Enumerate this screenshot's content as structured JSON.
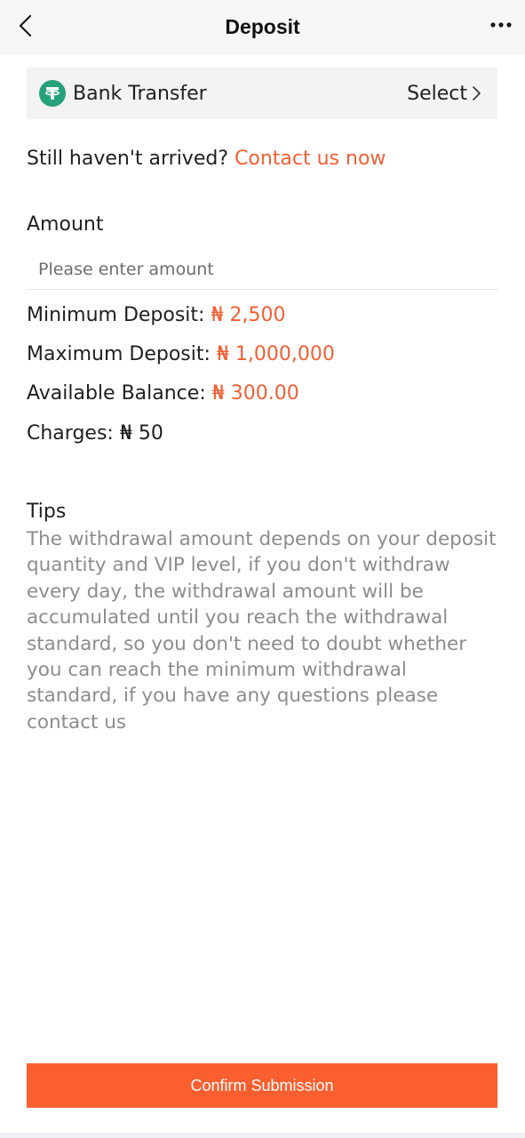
{
  "header": {
    "title": "Deposit",
    "back_icon": "chevron-left-icon",
    "more_icon": "more-dots-icon"
  },
  "payment_method": {
    "name": "Bank Transfer",
    "icon": "tether-icon",
    "icon_color": "#26a17b",
    "select_label": "Select"
  },
  "arrival": {
    "prompt": "Still haven't arrived?",
    "link": "Contact us now"
  },
  "amount": {
    "label": "Amount",
    "placeholder": "Please enter amount",
    "value": ""
  },
  "limits": {
    "min_label": "Minimum Deposit:",
    "min_value": "₦ 2,500",
    "max_label": "Maximum Deposit:",
    "max_value": "₦ 1,000,000",
    "balance_label": "Available Balance:",
    "balance_value": "₦ 300.00",
    "charges_label": "Charges:",
    "charges_value": "₦ 50"
  },
  "tips": {
    "title": "Tips",
    "body": "The withdrawal amount depends on your deposit quantity and VIP level, if you don't withdraw every day, the withdrawal amount will be accumulated until you reach the withdrawal standard, so you don't need to doubt whether you can reach the minimum withdrawal standard, if you have any questions please contact us"
  },
  "confirm_button": "Confirm Submission",
  "colors": {
    "accent": "#f25f35",
    "button": "#fb5f2f",
    "header_bg": "#f6f6f6"
  }
}
